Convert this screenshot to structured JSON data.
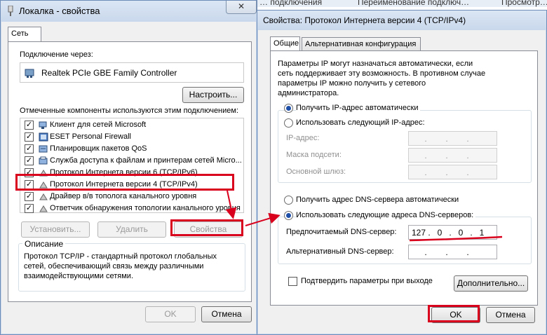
{
  "background_tabs": [
    "… подключения",
    "Переименование подключ…",
    "Просмотр…"
  ],
  "left_window": {
    "title": "Локалка - свойства",
    "close_label": "✕",
    "tab_network": "Сеть",
    "connect_via_label": "Подключение через:",
    "adapter_name": "Realtek PCIe GBE Family Controller",
    "configure_button": "Настроить...",
    "components_label": "Отмеченные компоненты используются этим подключением:",
    "components": [
      {
        "label": "Клиент для сетей Microsoft",
        "checked": true,
        "icon": "network-client-icon"
      },
      {
        "label": "ESET Personal Firewall",
        "checked": true,
        "icon": "firewall-icon"
      },
      {
        "label": "Планировщик пакетов QoS",
        "checked": true,
        "icon": "qos-scheduler-icon"
      },
      {
        "label": "Служба доступа к файлам и принтерам сетей Micro...",
        "checked": true,
        "icon": "file-printer-sharing-icon"
      },
      {
        "label": "Протокол Интернета версии 6 (TCP/IPv6)",
        "checked": true,
        "icon": "protocol-icon"
      },
      {
        "label": "Протокол Интернета версии 4 (TCP/IPv4)",
        "checked": true,
        "icon": "protocol-icon"
      },
      {
        "label": "Драйвер в/в тополога канального уровня",
        "checked": true,
        "icon": "protocol-icon"
      },
      {
        "label": "Ответчик обнаружения топологии канального уровня",
        "checked": true,
        "icon": "protocol-icon"
      }
    ],
    "install_button": "Установить...",
    "remove_button": "Удалить",
    "properties_button": "Свойства",
    "description_title": "Описание",
    "description_text": "Протокол TCP/IP - стандартный протокол глобальных сетей, обеспечивающий связь между различными взаимодействующими сетями.",
    "ok_button": "OK",
    "cancel_button": "Отмена"
  },
  "right_window": {
    "title": "Свойства: Протокол Интернета версии 4 (TCP/IPv4)",
    "tab_general": "Общие",
    "tab_alternate": "Альтернативная конфигурация",
    "intro_text": "Параметры IP могут назначаться автоматически, если сеть поддерживает эту возможность. В противном случае параметры IP можно получить у сетевого администратора.",
    "radio_ip_auto": "Получить IP-адрес автоматически",
    "radio_ip_manual": "Использовать следующий IP-адрес:",
    "ip_address_label": "IP-адрес:",
    "subnet_label": "Маска подсети:",
    "gateway_label": "Основной шлюз:",
    "radio_dns_auto": "Получить адрес DNS-сервера автоматически",
    "radio_dns_manual": "Использовать следующие адреса DNS-серверов:",
    "preferred_dns_label": "Предпочитаемый DNS-сервер:",
    "preferred_dns_octets": [
      "127",
      "0",
      "0",
      "1"
    ],
    "alternate_dns_label": "Альтернативный DNS-сервер:",
    "validate_label": "Подтвердить параметры при выходе",
    "advanced_button": "Дополнительно...",
    "ok_button": "OK",
    "cancel_button": "Отмена"
  },
  "colors": {
    "highlight": "#d8001c",
    "radio_selected": "#1e4fa8",
    "title_bar": "#c9d8ec"
  }
}
